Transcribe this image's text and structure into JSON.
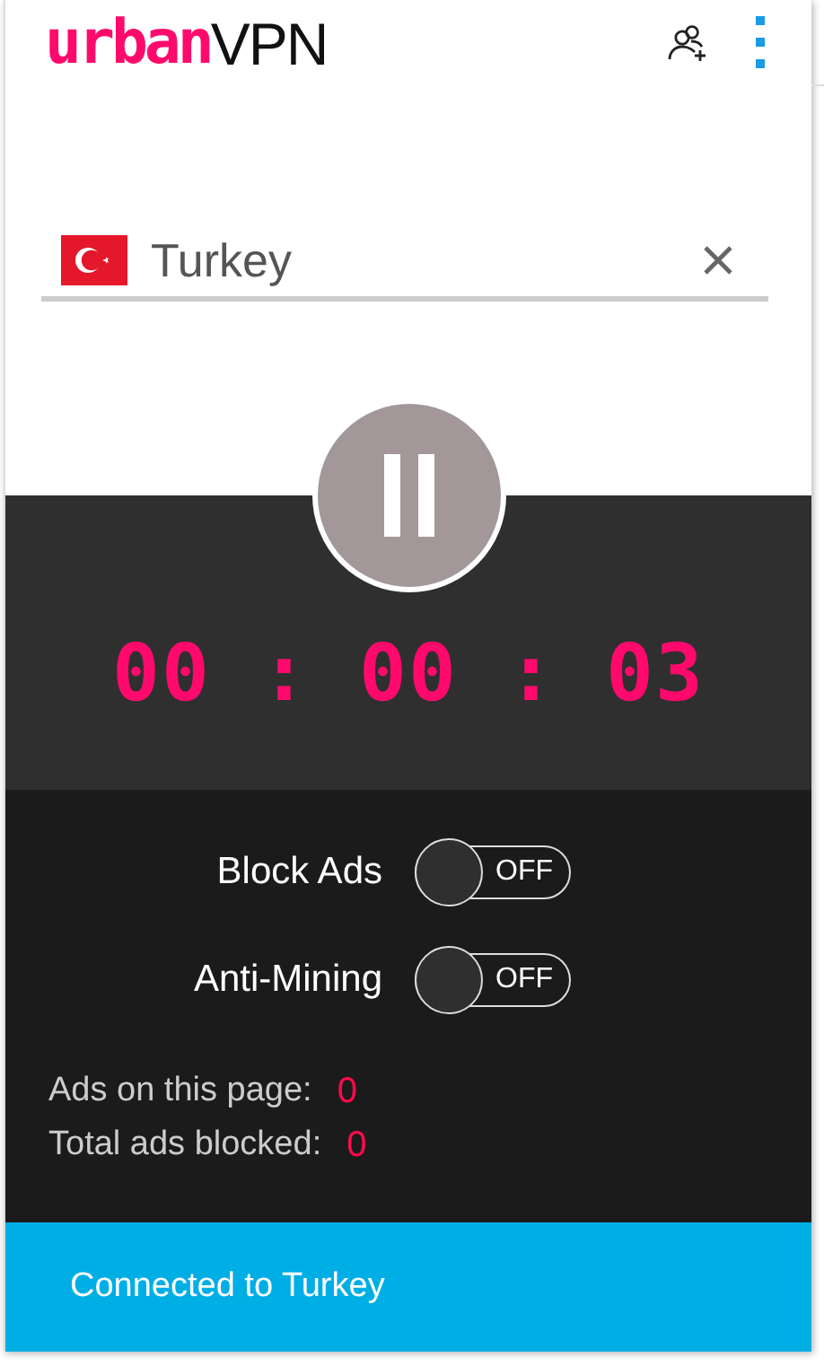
{
  "logo": {
    "brand": "urban",
    "suffix": "VPN"
  },
  "location": {
    "value": "Turkey"
  },
  "connect": {
    "connected": true
  },
  "timer": "00 : 00 : 03",
  "toggles": [
    {
      "kind": "toggle",
      "label": "Block Ads",
      "on": false,
      "state": "OFF"
    },
    {
      "kind": "toggle",
      "label": "Anti-Mining",
      "on": false,
      "state": "OFF"
    }
  ],
  "stats": [
    {
      "label": "Ads on this page:",
      "value": "0"
    },
    {
      "label": "Total ads blocked:",
      "value": "0"
    }
  ],
  "status_bar": "Connected to Turkey"
}
